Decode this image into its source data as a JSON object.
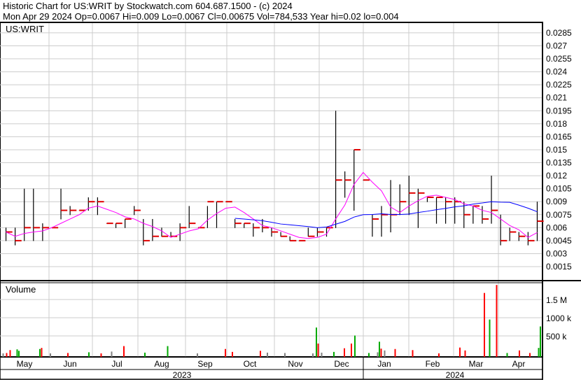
{
  "header": {
    "line1": "Historic Chart for US:WRIT by Stockwatch.com 604.687.1500 - (c) 2024",
    "line2": "Mon Apr 29 2024   Op=0.0067   Hi=0.009   Lo=0.0067   Cl=0.00675   Vol=784,533   Year hi=0.02   lo=0.004"
  },
  "chart_data": [
    {
      "type": "bar",
      "title": "US:WRIT",
      "subtype": "ohlc",
      "y_ticks": [
        "0.0285",
        "0.027",
        "0.0255",
        "0.024",
        "0.0225",
        "0.021",
        "0.0195",
        "0.018",
        "0.0165",
        "0.015",
        "0.0135",
        "0.012",
        "0.0105",
        "0.009",
        "0.0075",
        "0.006",
        "0.0045",
        "0.003",
        "0.0015"
      ],
      "ylim": [
        0,
        0.0295
      ],
      "x_months": [
        "May",
        "Jun",
        "Jul",
        "Aug",
        "Sep",
        "Oct",
        "Nov",
        "Dec",
        "Jan",
        "Feb",
        "Mar",
        "Apr"
      ],
      "x_years": [
        "2023",
        "2024"
      ],
      "bars_hlc": [
        [
          0.006,
          0.0045,
          0.0055
        ],
        [
          0.006,
          0.004,
          0.0045
        ],
        [
          0.0105,
          0.0045,
          0.006
        ],
        [
          0.0105,
          0.0045,
          0.006
        ],
        [
          0.0065,
          0.0045,
          0.006
        ],
        [
          0.006,
          0.006,
          0.006
        ],
        [
          0.0105,
          0.007,
          0.008
        ],
        [
          0.0085,
          0.0075,
          0.008
        ],
        [
          0.008,
          0.008,
          0.008
        ],
        [
          0.0095,
          0.008,
          0.009
        ],
        [
          0.0095,
          0.0075,
          0.009
        ],
        [
          0.0065,
          0.0065,
          0.0065
        ],
        [
          0.0065,
          0.006,
          0.0065
        ],
        [
          0.007,
          0.006,
          0.007
        ],
        [
          0.0085,
          0.0075,
          0.008
        ],
        [
          0.007,
          0.004,
          0.0045
        ],
        [
          0.007,
          0.0045,
          0.005
        ],
        [
          0.006,
          0.005,
          0.005
        ],
        [
          0.0055,
          0.005,
          0.005
        ],
        [
          0.0065,
          0.0045,
          0.006
        ],
        [
          0.0085,
          0.006,
          0.0065
        ],
        [
          0.006,
          0.006,
          0.006
        ],
        [
          0.0085,
          0.006,
          0.009
        ],
        [
          0.009,
          0.006,
          0.009
        ],
        [
          0.009,
          0.009,
          0.009
        ],
        [
          0.007,
          0.006,
          0.0065
        ],
        [
          0.0065,
          0.006,
          0.0065
        ],
        [
          0.0065,
          0.005,
          0.006
        ],
        [
          0.007,
          0.0055,
          0.006
        ],
        [
          0.006,
          0.005,
          0.0055
        ],
        [
          0.0055,
          0.005,
          0.005
        ],
        [
          0.005,
          0.0045,
          0.0045
        ],
        [
          0.0045,
          0.0045,
          0.0045
        ],
        [
          0.006,
          0.005,
          0.005
        ],
        [
          0.006,
          0.005,
          0.0055
        ],
        [
          0.006,
          0.005,
          0.006
        ],
        [
          0.0195,
          0.006,
          0.0115
        ],
        [
          0.0125,
          0.0095,
          0.0115
        ],
        [
          0.015,
          0.008,
          0.015
        ],
        [
          0.0115,
          0.0115,
          0.0115
        ],
        [
          0.0075,
          0.005,
          0.007
        ],
        [
          0.0085,
          0.005,
          0.0075
        ],
        [
          0.0115,
          0.0055,
          0.0075
        ],
        [
          0.011,
          0.0075,
          0.009
        ],
        [
          0.012,
          0.0075,
          0.01
        ],
        [
          0.0105,
          0.006,
          0.01
        ],
        [
          0.0095,
          0.009,
          0.0095
        ],
        [
          0.0095,
          0.0065,
          0.0095
        ],
        [
          0.0095,
          0.0065,
          0.009
        ],
        [
          0.0095,
          0.0065,
          0.009
        ],
        [
          0.009,
          0.006,
          0.0075
        ],
        [
          0.0085,
          0.0065,
          0.0085
        ],
        [
          0.0085,
          0.0065,
          0.007
        ],
        [
          0.012,
          0.0065,
          0.008
        ],
        [
          0.0075,
          0.004,
          0.0045
        ],
        [
          0.006,
          0.0045,
          0.0055
        ],
        [
          0.0055,
          0.0045,
          0.005
        ],
        [
          0.0055,
          0.004,
          0.0045
        ],
        [
          0.009,
          0.0045,
          0.00675
        ]
      ],
      "ma_short_color": "#ff00ff",
      "ma_long_color": "#0000ff"
    },
    {
      "type": "bar",
      "title": "Volume",
      "y_ticks": [
        "1.5 M",
        "1000 k",
        "500 k"
      ],
      "ylim": [
        0,
        1900000
      ],
      "series": [
        [
          1,
          20000,
          "#808080"
        ],
        [
          3,
          30000,
          "#ff0000"
        ],
        [
          5,
          110000,
          "#ff0000"
        ],
        [
          9,
          130000,
          "#00aa00"
        ],
        [
          10,
          90000,
          "#00aa00"
        ],
        [
          22,
          140000,
          "#00aa00"
        ],
        [
          23,
          170000,
          "#ff0000"
        ],
        [
          28,
          20000,
          "#808080"
        ],
        [
          38,
          30000,
          "#ff0000"
        ],
        [
          50,
          50000,
          "#00aa00"
        ],
        [
          57,
          20000,
          "#ff0000"
        ],
        [
          63,
          70000,
          "#808080"
        ],
        [
          70,
          220000,
          "#ff0000"
        ],
        [
          82,
          40000,
          "#00aa00"
        ],
        [
          95,
          220000,
          "#00aa00"
        ],
        [
          112,
          20000,
          "#808080"
        ],
        [
          128,
          140000,
          "#ff0000"
        ],
        [
          132,
          60000,
          "#ff0000"
        ],
        [
          148,
          90000,
          "#ff0000"
        ],
        [
          152,
          40000,
          "#808080"
        ],
        [
          162,
          30000,
          "#808080"
        ],
        [
          178,
          20000,
          "#808080"
        ],
        [
          180,
          730000,
          "#00aa00"
        ],
        [
          181,
          290000,
          "#ff0000"
        ],
        [
          183,
          40000,
          "#808080"
        ],
        [
          190,
          60000,
          "#00aa00"
        ],
        [
          196,
          160000,
          "#ff0000"
        ],
        [
          200,
          290000,
          "#ff0000"
        ],
        [
          202,
          510000,
          "#00aa00"
        ],
        [
          210,
          30000,
          "#00aa00"
        ],
        [
          215,
          50000,
          "#808080"
        ],
        [
          216,
          340000,
          "#00aa00"
        ],
        [
          217,
          150000,
          "#ff0000"
        ],
        [
          219,
          100000,
          "#808080"
        ],
        [
          225,
          140000,
          "#ff0000"
        ],
        [
          235,
          110000,
          "#ff0000"
        ],
        [
          250,
          20000,
          "#ff0000"
        ],
        [
          262,
          180000,
          "#ff0000"
        ],
        [
          265,
          100000,
          "#ff0000"
        ],
        [
          276,
          1680000,
          "#ff0000"
        ],
        [
          279,
          950000,
          "#00aa00"
        ],
        [
          283,
          2000000,
          "#ff0000"
        ],
        [
          289,
          30000,
          "#00aa00"
        ],
        [
          296,
          100000,
          "#ff0000"
        ],
        [
          302,
          30000,
          "#ff0000"
        ],
        [
          307,
          170000,
          "#00aa00"
        ],
        [
          308,
          760000,
          "#00aa00"
        ]
      ]
    }
  ]
}
